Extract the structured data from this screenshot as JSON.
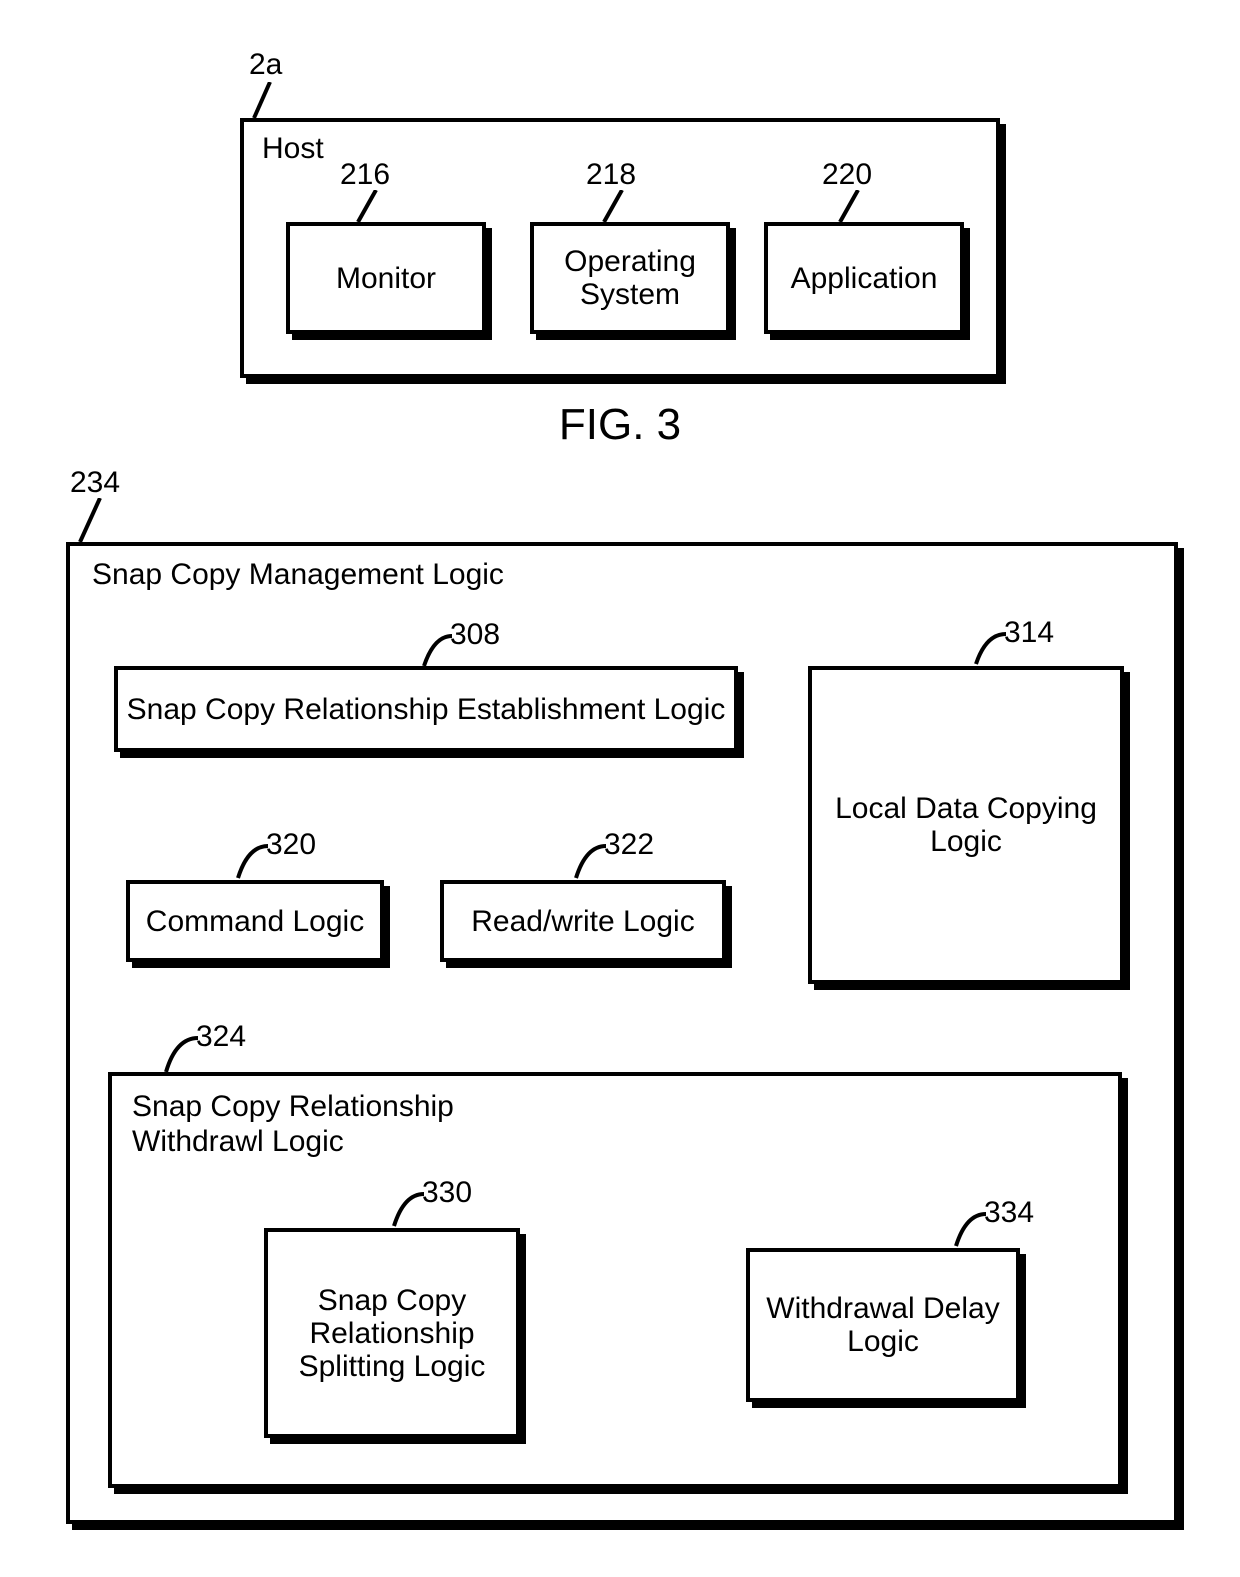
{
  "fig3": {
    "caption": "FIG. 3",
    "host_ref": "2a",
    "host_label": "Host",
    "monitor_ref": "216",
    "monitor_label": "Monitor",
    "os_ref": "218",
    "os_label": "Operating\nSystem",
    "app_ref": "220",
    "app_label": "Application"
  },
  "fig4": {
    "outer_ref": "234",
    "outer_label": "Snap Copy Management Logic",
    "est_ref": "308",
    "est_label": "Snap Copy Relationship Establishment Logic",
    "local_ref": "314",
    "local_label": "Local Data Copying Logic",
    "cmd_ref": "320",
    "cmd_label": "Command Logic",
    "rw_ref": "322",
    "rw_label": "Read/write Logic",
    "withdraw_ref": "324",
    "withdraw_label": "Snap Copy Relationship Withdrawl Logic",
    "split_ref": "330",
    "split_label": "Snap Copy Relationship Splitting Logic",
    "delay_ref": "334",
    "delay_label": "Withdrawal Delay Logic"
  }
}
